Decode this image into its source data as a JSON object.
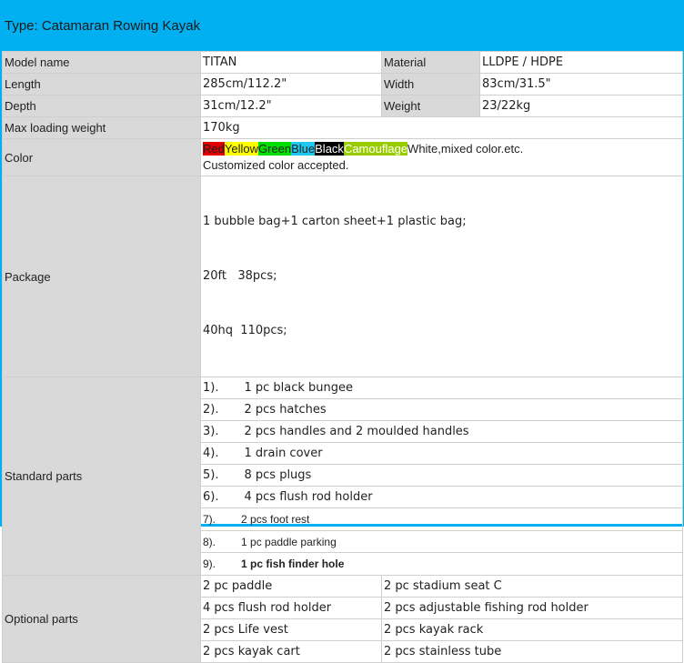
{
  "header": {
    "title": "Type:  Catamaran Rowing Kayak"
  },
  "colors": {
    "accent": "#00b0f0",
    "label_bg": "#d9d9d9"
  },
  "specs": {
    "model_label": "Model name",
    "model": "TITAN",
    "material_label": "Material",
    "material": "LLDPE / HDPE",
    "length_label": "Length",
    "length": "285cm/112.2\"",
    "width_label": "Width",
    "width": "83cm/31.5\"",
    "depth_label": "Depth",
    "depth": "31cm/12.2\"",
    "weight_label": "Weight",
    "weight": "23/22kg",
    "max_label": "Max loading weight",
    "max": "170kg"
  },
  "color": {
    "label": "Color",
    "swatches": [
      {
        "text": "Red",
        "bg": "#e00000",
        "fg": "#222"
      },
      {
        "text": "Yellow",
        "bg": "#ffff00",
        "fg": "#222"
      },
      {
        "text": "Green",
        "bg": "#00e000",
        "fg": "#222"
      },
      {
        "text": "Blue",
        "bg": "#1ec8f0",
        "fg": "#222"
      },
      {
        "text": "Black",
        "bg": "#000000",
        "fg": "#fff"
      },
      {
        "text": "Camouflage",
        "bg": "#99cc00",
        "fg": "#fff"
      }
    ],
    "rest": "White,mixed color.etc.",
    "note": "Customized color accepted."
  },
  "package": {
    "label": "Package",
    "lines": [
      "1 bubble bag+1 carton sheet+1 plastic bag;",
      "20ft   38pcs;",
      "40hq  110pcs;"
    ]
  },
  "standard": {
    "label": "Standard parts",
    "items": [
      {
        "num": "1).",
        "text": "1 pc black bungee"
      },
      {
        "num": "2).",
        "text": "2 pcs hatches"
      },
      {
        "num": "3).",
        "text": "2 pcs handles and 2 moulded handles"
      },
      {
        "num": "4).",
        "text": "1 drain cover"
      },
      {
        "num": "5).",
        "text": "8 pcs plugs"
      },
      {
        "num": "6).",
        "text": "4 pcs flush rod holder"
      },
      {
        "num": "7).",
        "text": "2 pcs foot rest"
      },
      {
        "num": "8).",
        "text": "1 pc paddle parking"
      },
      {
        "num": "9).",
        "text": "1 pc fish finder hole"
      }
    ]
  },
  "optional": {
    "label": "Optional parts",
    "rows": [
      [
        "2 pc paddle",
        "2 pc stadium seat C"
      ],
      [
        "4 pcs flush rod holder",
        "2 pcs adjustable fishing rod holder"
      ],
      [
        "2 pcs Life vest",
        "2 pcs kayak rack"
      ],
      [
        "2 pcs kayak cart",
        "2 pcs stainless tube"
      ]
    ]
  }
}
